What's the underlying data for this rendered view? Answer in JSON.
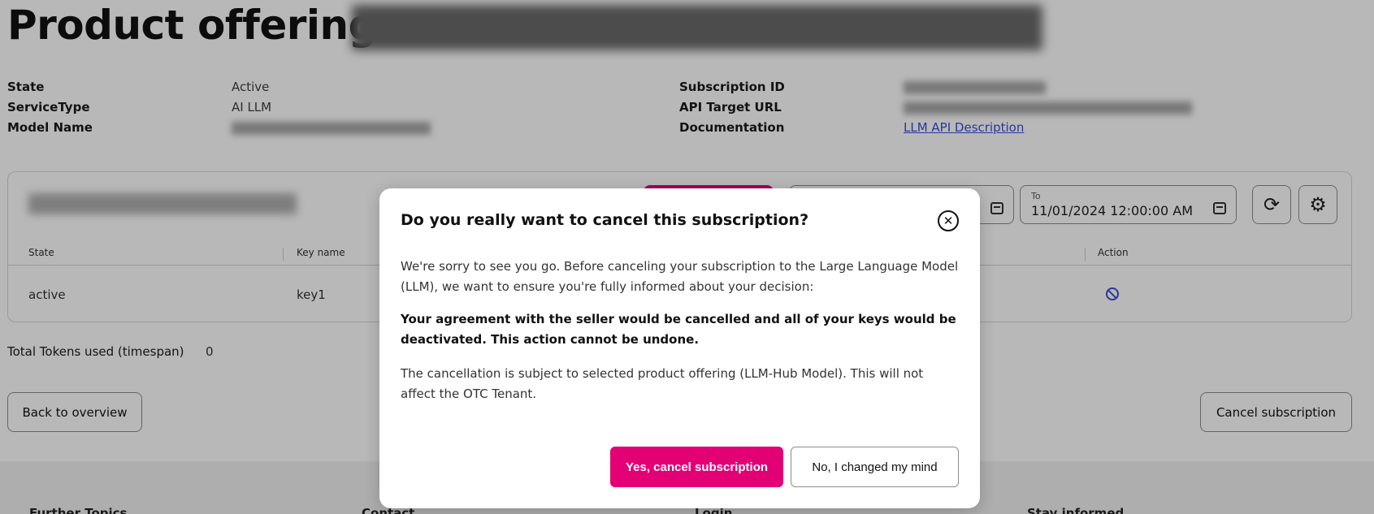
{
  "page": {
    "title_prefix": "Product offering:"
  },
  "details_left": [
    {
      "label": "State",
      "value": "Active"
    },
    {
      "label": "ServiceType",
      "value": "AI LLM"
    },
    {
      "label": "Model Name",
      "value": ""
    }
  ],
  "details_right": [
    {
      "label": "Subscription ID",
      "value": ""
    },
    {
      "label": "API Target URL",
      "value": ""
    },
    {
      "label": "Documentation",
      "value": "LLM API Description"
    }
  ],
  "keys_card": {
    "date_to_label": "To",
    "date_to_value": "11/01/2024 12:00:00 AM",
    "columns": [
      "State",
      "Key name",
      "Action"
    ],
    "rows": [
      {
        "state": "active",
        "key_name": "key1"
      }
    ]
  },
  "tokens": {
    "label": "Total Tokens used (timespan)",
    "value": "0"
  },
  "buttons": {
    "back": "Back to overview",
    "cancel_subscription": "Cancel subscription"
  },
  "footer": {
    "columns": [
      "Further Topics",
      "Contact",
      "Login",
      "Stay informed"
    ]
  },
  "modal": {
    "title": "Do you really want to cancel this subscription?",
    "paragraph1": "We're sorry to see you go. Before canceling your subscription to the Large Language Model (LLM), we want to ensure you're fully informed about your decision:",
    "paragraph2": "Your agreement with the seller would be cancelled and all of your keys would be deactivated. This action cannot be undone.",
    "paragraph3": "The cancellation is subject to selected product offering (LLM-Hub Model). This will not affect the OTC Tenant.",
    "confirm_label": "Yes, cancel subscription",
    "decline_label": "No, I changed my mind",
    "close_glyph": "✕"
  },
  "colors": {
    "brand_magenta": "#e20074",
    "link_blue": "#3b4bd6"
  }
}
